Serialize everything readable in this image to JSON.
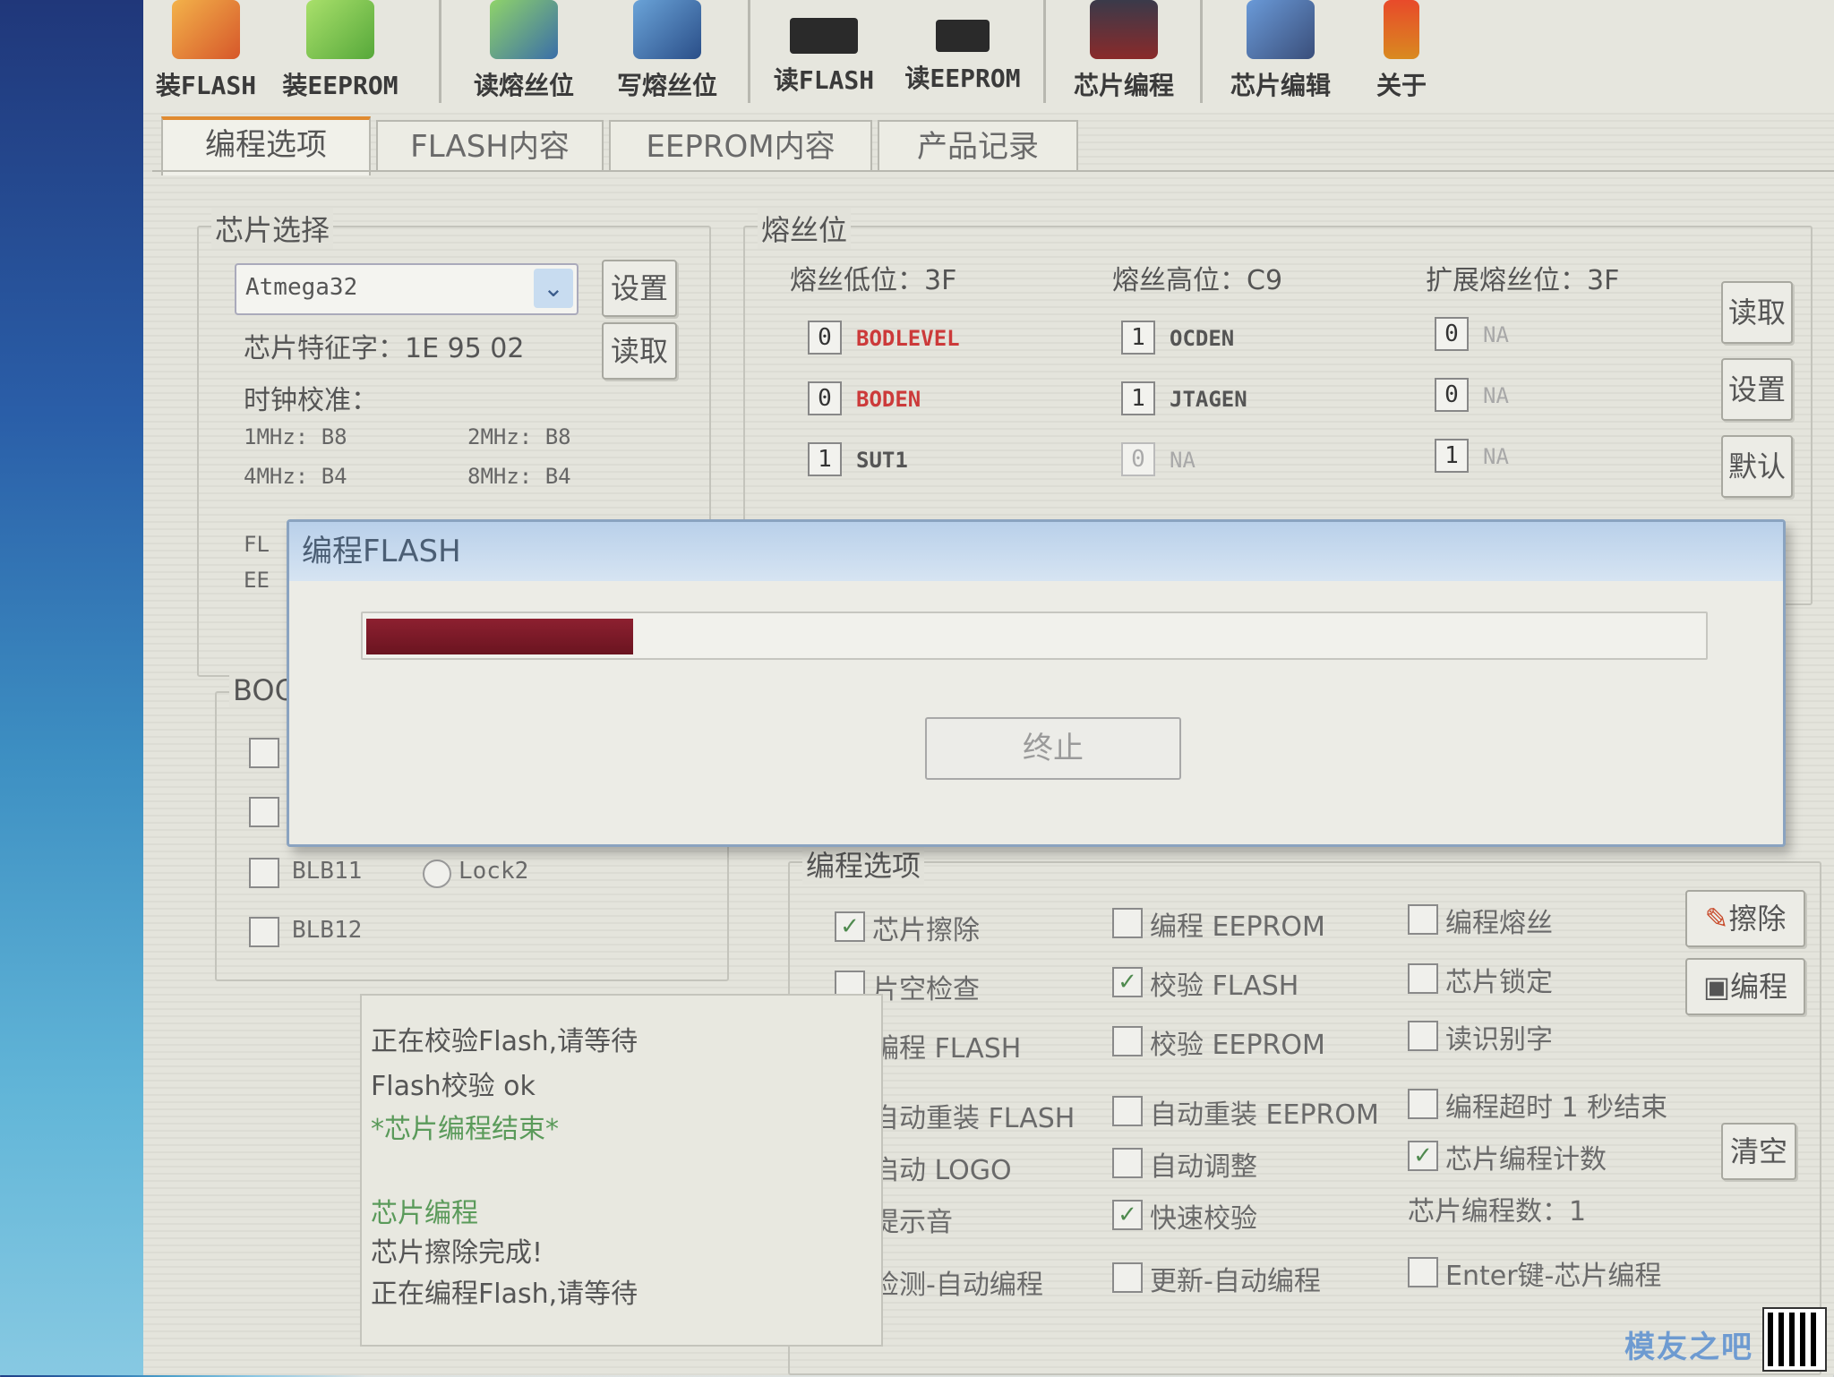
{
  "toolbar": {
    "items": [
      {
        "label": "装FLASH",
        "icon": "load-flash-icon",
        "color": "#d6572a"
      },
      {
        "label": "装EEPROM",
        "icon": "load-eeprom-icon",
        "color": "#56a83a"
      },
      {
        "label": "读熔丝位",
        "icon": "read-fuse-icon",
        "color": "#3a6ea8"
      },
      {
        "label": "写熔丝位",
        "icon": "write-fuse-icon",
        "color": "#3a6ea8"
      },
      {
        "label": "读FLASH",
        "icon": "read-flash-chip-icon",
        "color": "#222222"
      },
      {
        "label": "读EEPROM",
        "icon": "read-eeprom-chip-icon",
        "color": "#222222"
      },
      {
        "label": "芯片编程",
        "icon": "chip-program-icon",
        "color": "#8a2a2a"
      },
      {
        "label": "芯片编辑",
        "icon": "chip-edit-icon",
        "color": "#3a4e7a"
      },
      {
        "label": "关于",
        "icon": "about-icon",
        "color": "#d98a20"
      }
    ]
  },
  "tabs": [
    {
      "label": "编程选项",
      "active": true
    },
    {
      "label": "FLASH内容",
      "active": false
    },
    {
      "label": "EEPROM内容",
      "active": false
    },
    {
      "label": "产品记录",
      "active": false
    }
  ],
  "chip_select": {
    "legend": "芯片选择",
    "selected_chip": "Atmega32",
    "set_button": "设置",
    "signature_label": "芯片特征字：1E 95 02",
    "read_button": "读取",
    "clock_label": "时钟校准：",
    "clock_1": "1MHz: B8",
    "clock_2": "2MHz: B8",
    "clock_4": "4MHz: B4",
    "clock_8": "8MHz: B4",
    "partial_1": "FL",
    "partial_2": "EE"
  },
  "fuses": {
    "legend": "熔丝位",
    "low_label": "熔丝低位：3F",
    "high_label": "熔丝高位：C9",
    "ext_label": "扩展熔丝位：3F",
    "low_bits": [
      {
        "value": "0",
        "name": "BODLEVEL",
        "red": true
      },
      {
        "value": "0",
        "name": "BODEN",
        "red": true
      },
      {
        "value": "1",
        "name": "SUT1",
        "red": false
      }
    ],
    "high_bits": [
      {
        "value": "1",
        "name": "OCDEN",
        "faint": false
      },
      {
        "value": "1",
        "name": "JTAGEN",
        "faint": false
      },
      {
        "value": "0",
        "name": "NA",
        "faint": true
      }
    ],
    "ext_bits": [
      {
        "value": "0",
        "name": "NA"
      },
      {
        "value": "0",
        "name": "NA"
      },
      {
        "value": "1",
        "name": "NA"
      }
    ],
    "read_button": "读取",
    "set_button": "设置",
    "default_button": "默认"
  },
  "boot": {
    "legend": "BOOT",
    "blb11": "BLB11",
    "blb12": "BLB12",
    "lock2": "Lock2"
  },
  "log": {
    "lines": [
      {
        "text": "正在校验Flash,请等待",
        "green": false
      },
      {
        "text": "Flash校验   ok",
        "green": false
      },
      {
        "text": "*芯片编程结束*",
        "green": true
      },
      {
        "text": "",
        "green": false
      },
      {
        "text": "芯片编程",
        "green": true
      },
      {
        "text": "芯片擦除完成!",
        "green": false
      },
      {
        "text": "正在编程Flash,请等待",
        "green": false
      }
    ]
  },
  "prog_options": {
    "legend": "编程选项",
    "col1": [
      {
        "label": "芯片擦除",
        "checked": true
      },
      {
        "label": "片空检查",
        "checked": false
      },
      {
        "label": "编程 FLASH",
        "checked": true
      },
      {
        "label": "自动重装 FLASH",
        "checked": true
      },
      {
        "label": "启动 LOGO",
        "checked": true
      },
      {
        "label": "提示音",
        "checked": true
      },
      {
        "label": "检测-自动编程",
        "checked": false
      }
    ],
    "col2": [
      {
        "label": "编程 EEPROM",
        "checked": false
      },
      {
        "label": "校验 FLASH",
        "checked": true
      },
      {
        "label": "校验 EEPROM",
        "checked": false
      },
      {
        "label": "自动重装 EEPROM",
        "checked": false
      },
      {
        "label": "自动调整",
        "checked": false
      },
      {
        "label": "快速校验",
        "checked": true
      },
      {
        "label": "更新-自动编程",
        "checked": false
      }
    ],
    "col3": [
      {
        "label": "编程熔丝",
        "checked": false
      },
      {
        "label": "芯片锁定",
        "checked": false
      },
      {
        "label": "读识别字",
        "checked": false
      },
      {
        "label": "编程超时 1 秒结束",
        "checked": false
      },
      {
        "label": "芯片编程计数",
        "checked": true
      }
    ],
    "count_label": "芯片编程数：1",
    "enter_key": {
      "label": "Enter键-芯片编程",
      "checked": false
    },
    "erase_button": "擦除",
    "program_button": "编程",
    "clear_button": "清空"
  },
  "modal": {
    "title": "编程FLASH",
    "progress": 0.2,
    "stop_button": "终止"
  },
  "watermark": "模友之吧"
}
